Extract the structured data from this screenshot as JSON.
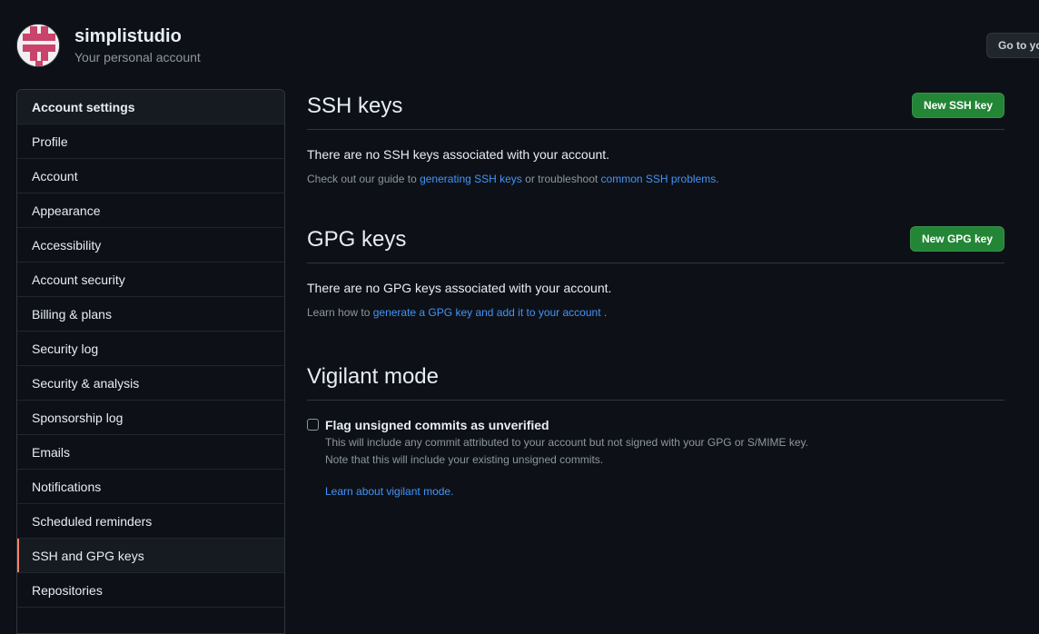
{
  "header": {
    "account_name": "simplistudio",
    "account_subtitle": "Your personal account",
    "goto_button_label": "Go to your personal profile"
  },
  "sidebar": {
    "heading": "Account settings",
    "items": [
      {
        "label": "Profile"
      },
      {
        "label": "Account"
      },
      {
        "label": "Appearance"
      },
      {
        "label": "Accessibility"
      },
      {
        "label": "Account security"
      },
      {
        "label": "Billing & plans"
      },
      {
        "label": "Security log"
      },
      {
        "label": "Security & analysis"
      },
      {
        "label": "Sponsorship log"
      },
      {
        "label": "Emails"
      },
      {
        "label": "Notifications"
      },
      {
        "label": "Scheduled reminders"
      },
      {
        "label": "SSH and GPG keys",
        "selected": true
      },
      {
        "label": "Repositories"
      }
    ]
  },
  "ssh": {
    "title": "SSH keys",
    "button_label": "New SSH key",
    "empty_text": "There are no SSH keys associated with your account.",
    "note_prefix": "Check out our guide to ",
    "note_link1": "generating SSH keys",
    "note_middle": " or troubleshoot ",
    "note_link2": "common SSH problems",
    "note_suffix": "."
  },
  "gpg": {
    "title": "GPG keys",
    "button_label": "New GPG key",
    "empty_text": "There are no GPG keys associated with your account.",
    "note_prefix": "Learn how to ",
    "note_link": "generate a GPG key and add it to your account",
    "note_suffix": " ."
  },
  "vigilant": {
    "title": "Vigilant mode",
    "checkbox_label": "Flag unsigned commits as unverified",
    "checked": false,
    "description_line1": "This will include any commit attributed to your account but not signed with your GPG or S/MIME key.",
    "description_line2": "Note that this will include your existing unsigned commits.",
    "learn_link": "Learn about vigilant mode."
  },
  "colors": {
    "background": "#0d1117",
    "accent_link": "#4493f8",
    "primary_button": "#238636",
    "selected_indicator": "#f78166"
  },
  "icons": {
    "avatar": "identicon-avatar"
  }
}
